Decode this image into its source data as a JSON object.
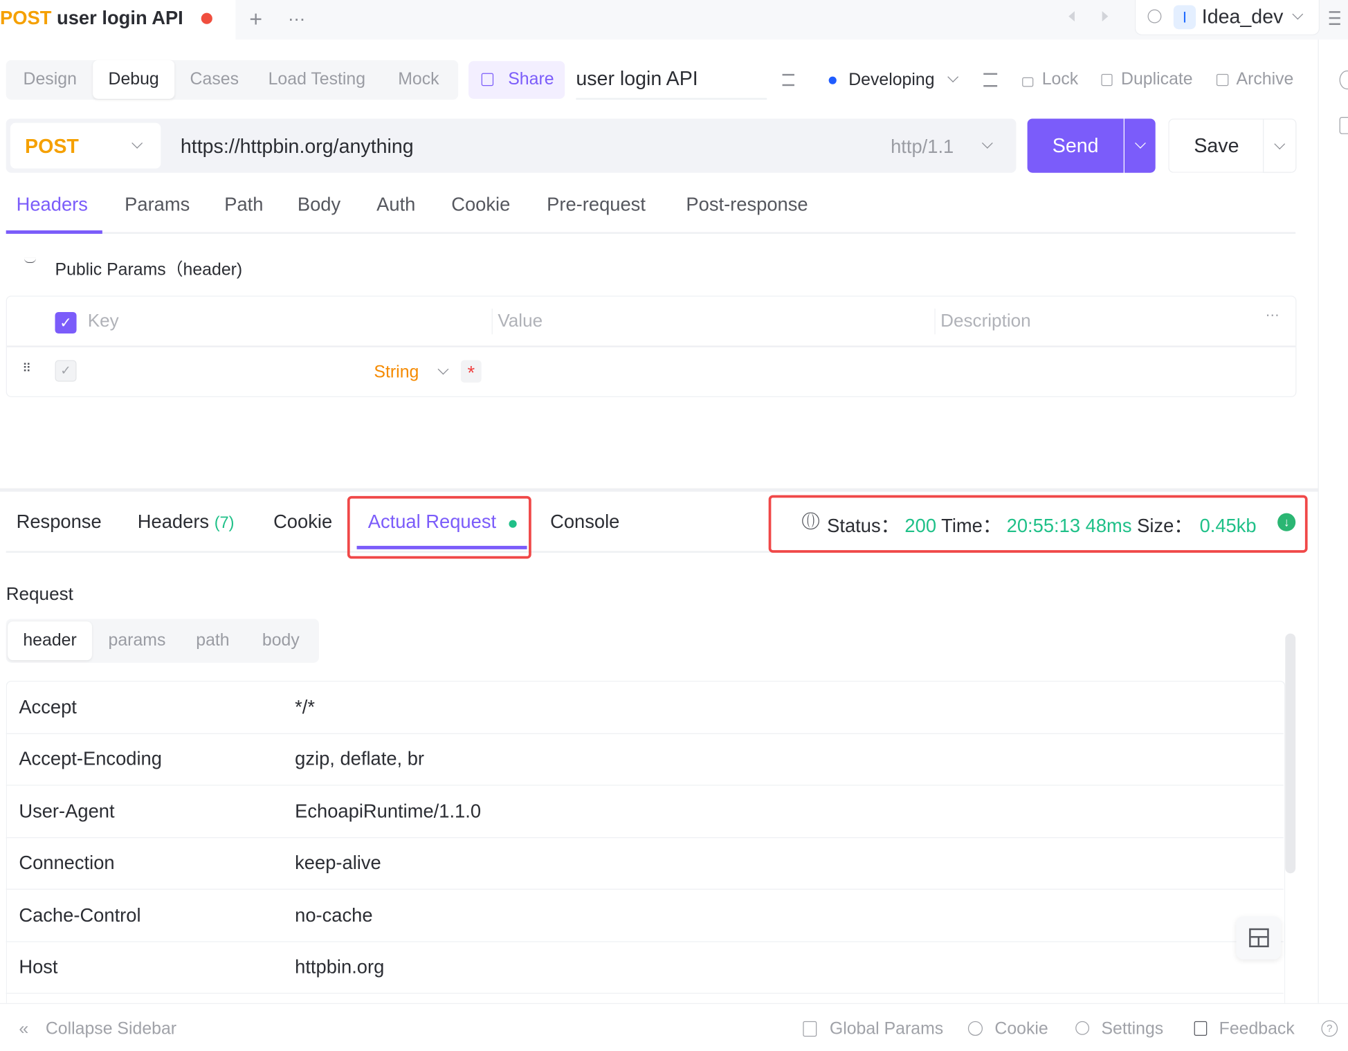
{
  "window_tab": {
    "method": "POST",
    "title": "user login API",
    "unsaved_color": "#f04e3e",
    "new_tab": "+",
    "more": "⋯"
  },
  "workspace": {
    "avatar_letter": "I",
    "name": "Idea_dev"
  },
  "mode_tabs": [
    {
      "label": "Design"
    },
    {
      "label": "Debug",
      "active": true
    },
    {
      "label": "Cases"
    },
    {
      "label": "Load Testing"
    },
    {
      "label": "Mock"
    }
  ],
  "toolbar": {
    "share": "Share",
    "api_name": "user login API",
    "status": "Developing",
    "status_color": "#1f5cff",
    "lock": "Lock",
    "duplicate": "Duplicate",
    "archive": "Archive"
  },
  "request": {
    "method": "POST",
    "url": "https://httpbin.org/anything",
    "protocol": "http/1.1",
    "send": "Send",
    "save": "Save"
  },
  "request_tabs": [
    {
      "label": "Headers",
      "active": true
    },
    {
      "label": "Params"
    },
    {
      "label": "Path"
    },
    {
      "label": "Body"
    },
    {
      "label": "Auth"
    },
    {
      "label": "Cookie"
    },
    {
      "label": "Pre-request"
    },
    {
      "label": "Post-response"
    }
  ],
  "public_params": "Public Params（header)",
  "params_table": {
    "columns": [
      "Key",
      "Value",
      "Description"
    ],
    "row": {
      "type": "String",
      "required": "*"
    }
  },
  "response_tabs": [
    {
      "label": "Response"
    },
    {
      "label": "Headers",
      "count": "(7)"
    },
    {
      "label": "Cookie"
    },
    {
      "label": "Actual Request",
      "active": true
    },
    {
      "label": "Console"
    }
  ],
  "response_status": {
    "status_label": "Status：",
    "status": "200",
    "time_label": "Time：",
    "time": "20:55:13",
    "duration": "48ms",
    "size_label": "Size：",
    "size": "0.45kb"
  },
  "actual_request": {
    "section_title": "Request",
    "sub_tabs": [
      {
        "label": "header",
        "active": true
      },
      {
        "label": "params"
      },
      {
        "label": "path"
      },
      {
        "label": "body"
      }
    ],
    "headers": [
      {
        "key": "Accept",
        "value": "*/*"
      },
      {
        "key": "Accept-Encoding",
        "value": "gzip, deflate, br"
      },
      {
        "key": "User-Agent",
        "value": "EchoapiRuntime/1.1.0"
      },
      {
        "key": "Connection",
        "value": "keep-alive"
      },
      {
        "key": "Cache-Control",
        "value": "no-cache"
      },
      {
        "key": "Host",
        "value": "httpbin.org"
      }
    ]
  },
  "footer": {
    "collapse": "Collapse Sidebar",
    "global_params": "Global Params",
    "cookie": "Cookie",
    "settings": "Settings",
    "feedback": "Feedback"
  },
  "colors": {
    "accent": "#7b5cfa",
    "method": "#f5a000",
    "success": "#1fc088",
    "highlight": "#f04848"
  }
}
